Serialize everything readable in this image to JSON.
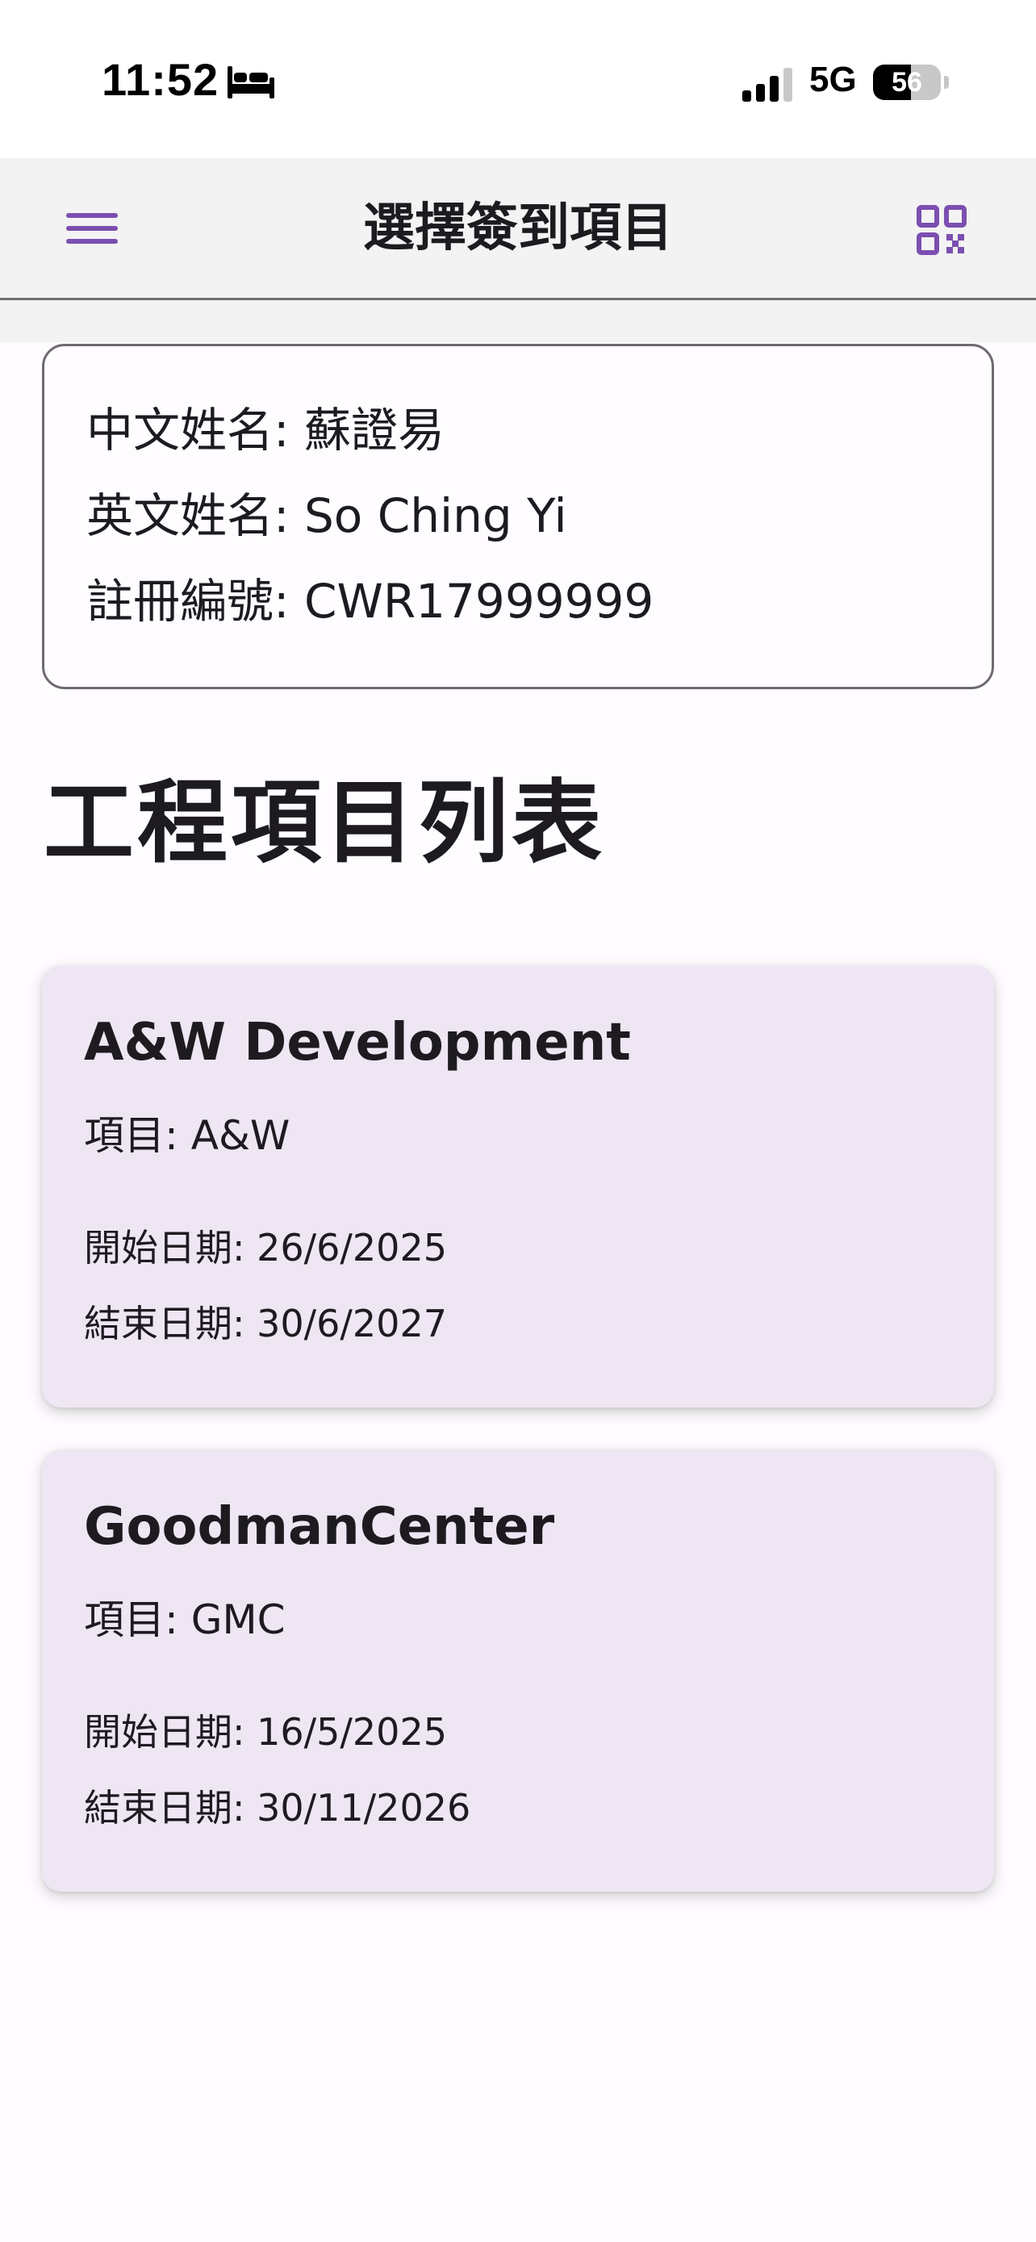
{
  "status_bar": {
    "time": "11:52",
    "sleep_icon": "bed-icon",
    "signal_icon": "cellular-signal-icon",
    "network": "5G",
    "battery_percent": 56,
    "battery_text": "56"
  },
  "app_bar": {
    "title": "選擇簽到項目",
    "menu_icon": "hamburger-menu-icon",
    "qr_icon": "qr-code-icon",
    "accent_color": "#7b4fb0"
  },
  "worker": {
    "chinese_name": "中文姓名: 蘇證易",
    "english_name": "英文姓名: So Ching Yi",
    "registration_no": "註冊編號: CWR17999999"
  },
  "section_title": "工程項目列表",
  "projects": [
    {
      "name": "A&W Development",
      "code": "項目: A&W",
      "start_date": "開始日期: 26/6/2025",
      "end_date": "結束日期: 30/6/2027"
    },
    {
      "name": "GoodmanCenter",
      "code": "項目: GMC",
      "start_date": "開始日期: 16/5/2025",
      "end_date": "結束日期: 30/11/2026"
    }
  ],
  "colors": {
    "card_background": "#efe6f4",
    "app_bar_background": "#f2f3f2",
    "text": "#1d1b20"
  }
}
